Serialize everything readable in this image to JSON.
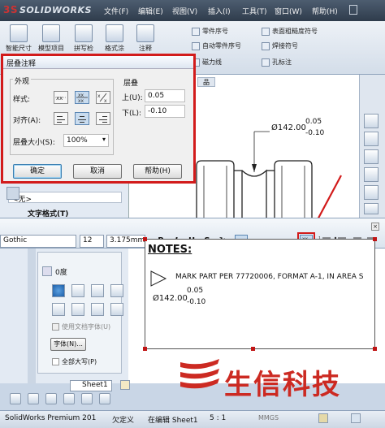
{
  "app": {
    "logo": "SOLIDWORKS",
    "status_product": "SolidWorks Premium 201",
    "status_undefined": "欠定义",
    "status_editing": "在编辑 Sheet1",
    "status_scale": "5 : 1",
    "status_units": "MMGS"
  },
  "menu": [
    "文件(F)",
    "编辑(E)",
    "视图(V)",
    "插入(I)",
    "工具(T)",
    "窗口(W)",
    "帮助(H)"
  ],
  "ribbon": {
    "big": [
      "智能尺寸",
      "模型项目",
      "拼写检",
      "格式涂",
      "注释"
    ],
    "small": [
      "零件序号",
      "自动零件序号",
      "磁力线",
      "表面粗糙度符号",
      "焊接符号",
      "孔标注"
    ]
  },
  "dialog": {
    "title": "层叠注释",
    "appearance_label": "外观",
    "style_label": "样式:",
    "align_label": "对齐(A):",
    "size_label": "层叠大小(S):",
    "size_value": "100%",
    "stack_label": "层叠",
    "upper_label": "上(U):",
    "upper_value": "0.05",
    "lower_label": "下(L):",
    "lower_value": "-0.10",
    "ok": "确定",
    "cancel": "取消",
    "help": "帮助(H)"
  },
  "drawing": {
    "dim": "Ø142.00",
    "tol_up": "0.05",
    "tol_down": "-0.10",
    "tab_suffix": "品"
  },
  "left_panel": {
    "none_value": "<无>",
    "text_format": "文字格式(T)"
  },
  "format_toolbar": {
    "font": "Gothic",
    "size": "12",
    "height": "3.175mm",
    "bold": "B",
    "italic": "I",
    "underline": "U",
    "strike": "S"
  },
  "lower_left": {
    "angle": "0度",
    "use_doc_font": "使用文档字体(U)",
    "font_button": "字体(N)...",
    "all_caps": "全部大写(P)"
  },
  "notes": {
    "heading": "NOTES:",
    "line1": "MARK PART PER 77720006, FORMAT A-1, IN AREA S",
    "dim": "Ø142.00",
    "tol_up": "0.05",
    "tol_down": "-0.10"
  },
  "sheet_tab": "Sheet1",
  "watermark": "生信科技",
  "colors": {
    "highlight_red": "#d21b1b",
    "watermark_red": "#cc2a22"
  }
}
